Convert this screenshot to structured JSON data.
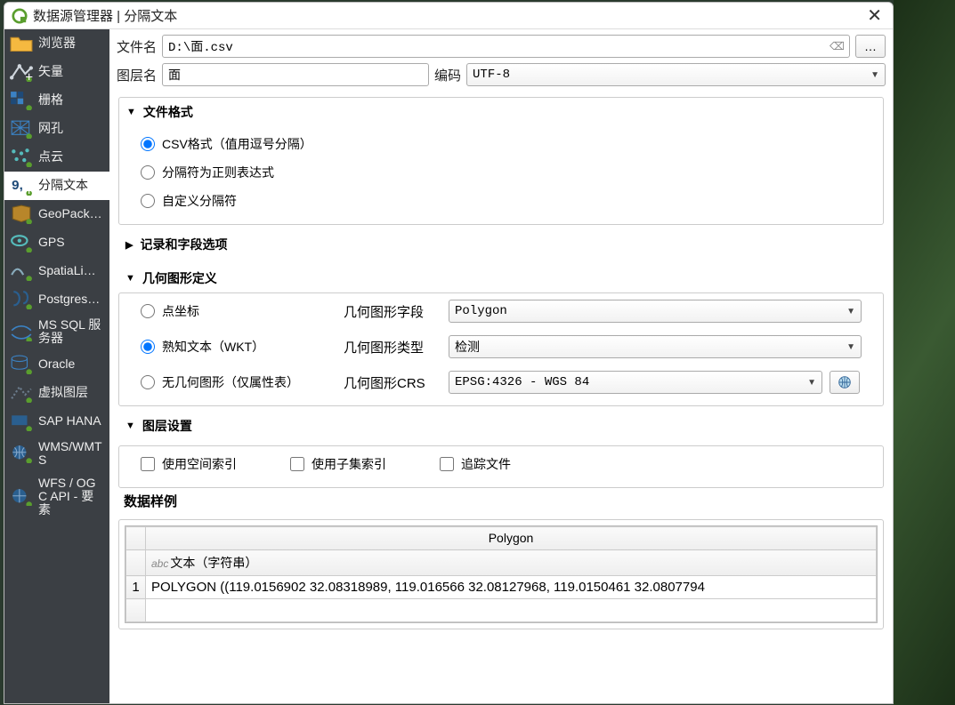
{
  "titlebar": {
    "title": "数据源管理器 | 分隔文本"
  },
  "sidebar": {
    "items": [
      {
        "label": "浏览器"
      },
      {
        "label": "矢量"
      },
      {
        "label": "栅格"
      },
      {
        "label": "网孔"
      },
      {
        "label": "点云"
      },
      {
        "label": "分隔文本"
      },
      {
        "label": "GeoPack…"
      },
      {
        "label": "GPS"
      },
      {
        "label": "SpatiaLi…"
      },
      {
        "label": "Postgres…"
      },
      {
        "label": "MS SQL 服务器"
      },
      {
        "label": "Oracle"
      },
      {
        "label": "虚拟图层"
      },
      {
        "label": "SAP HANA"
      },
      {
        "label": "WMS/WMTS"
      },
      {
        "label": "WFS / OGC API - 要素"
      }
    ]
  },
  "filerow": {
    "filename_label": "文件名",
    "filename_value": "D:\\面.csv",
    "browse_label": "…",
    "layername_label": "图层名",
    "layername_value": "面",
    "encoding_label": "编码",
    "encoding_value": "UTF-8"
  },
  "fileformat": {
    "title": "文件格式",
    "opt_csv": "CSV格式（值用逗号分隔）",
    "opt_regex": "分隔符为正则表达式",
    "opt_custom": "自定义分隔符"
  },
  "records": {
    "title": "记录和字段选项"
  },
  "geometry": {
    "title": "几何图形定义",
    "opt_point": "点坐标",
    "opt_wkt": "熟知文本（WKT）",
    "opt_none": "无几何图形（仅属性表）",
    "field_label": "几何图形字段",
    "field_value": "Polygon",
    "type_label": "几何图形类型",
    "type_value": "检测",
    "crs_label": "几何图形CRS",
    "crs_value": "EPSG:4326 - WGS 84"
  },
  "layersettings": {
    "title": "图层设置",
    "chk_spatial": "使用空间索引",
    "chk_subset": "使用子集索引",
    "chk_watch": "追踪文件"
  },
  "sample": {
    "title": "数据样例",
    "col_header": "Polygon",
    "type_header": "文本（字符串）",
    "row1": "POLYGON ((119.0156902 32.08318989, 119.016566 32.08127968, 119.0150461 32.0807794"
  }
}
